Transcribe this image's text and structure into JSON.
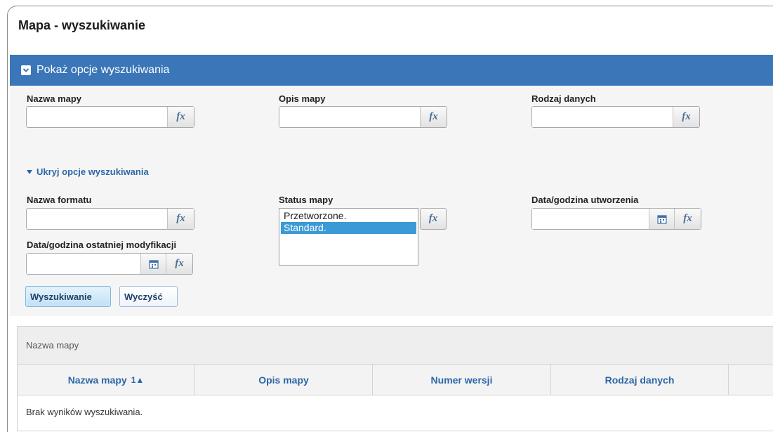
{
  "page": {
    "title": "Mapa - wyszukiwanie"
  },
  "panel": {
    "header": "Pokaż opcje wyszukiwania",
    "toggle": "Ukryj opcje wyszukiwania"
  },
  "fields": {
    "nazwa_mapy": {
      "label": "Nazwa mapy",
      "value": ""
    },
    "opis_mapy": {
      "label": "Opis mapy",
      "value": ""
    },
    "rodzaj_danych": {
      "label": "Rodzaj danych",
      "value": ""
    },
    "nazwa_formatu": {
      "label": "Nazwa formatu",
      "value": ""
    },
    "status_mapy": {
      "label": "Status mapy",
      "options": [
        "Przetworzone.",
        "Standard."
      ],
      "selected": "Standard."
    },
    "data_utworzenia": {
      "label": "Data/godzina utworzenia",
      "value": ""
    },
    "data_modyfikacji": {
      "label": "Data/godzina ostatniej modyfikacji",
      "value": ""
    }
  },
  "buttons": {
    "fx": "fx",
    "search": "Wyszukiwanie",
    "clear": "Wyczyść"
  },
  "results": {
    "title": "Nazwa mapy",
    "columns": [
      "Nazwa mapy",
      "Opis mapy",
      "Numer wersji",
      "Rodzaj danych"
    ],
    "sort": "1▲",
    "empty": "Brak wyników wyszukiwania."
  },
  "icons": {
    "header": "checkbox-chevron-icon",
    "toggle": "caret-down-icon",
    "calendar": "calendar-icon",
    "fx": "fx-icon"
  },
  "colors": {
    "header_bg": "#3a76b8",
    "link": "#2c67a7",
    "selected": "#3b9ad6"
  }
}
